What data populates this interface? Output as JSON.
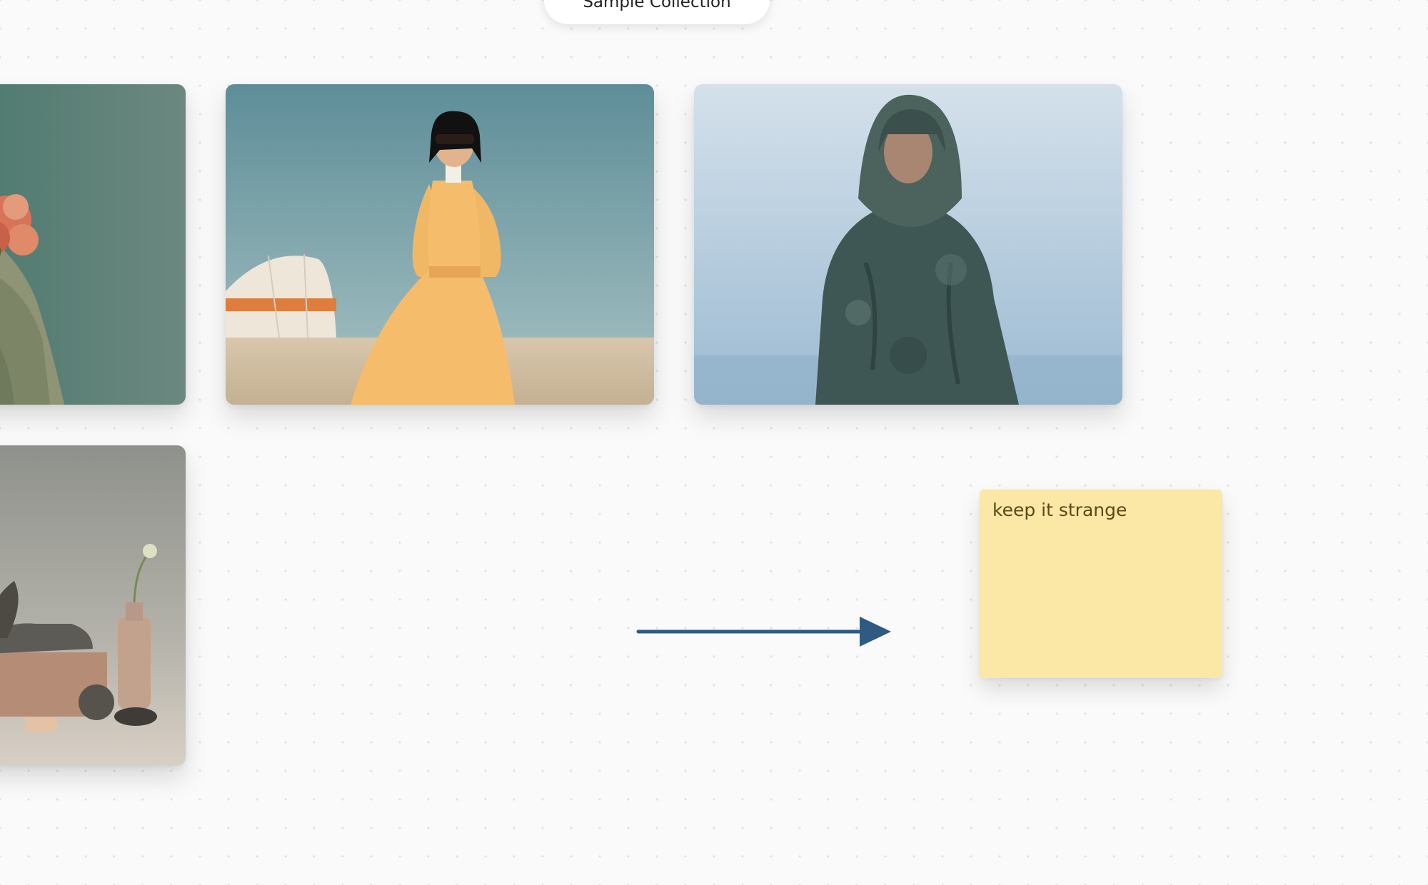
{
  "canvas": {
    "collection_title": "Sample Collection"
  },
  "images": [
    {
      "subject": "figure-with-flowers"
    },
    {
      "subject": "woman-yellow-dress-desert-dome"
    },
    {
      "subject": "hooded-man-camo-jacket"
    },
    {
      "subject": "shoe-still-life"
    }
  ],
  "arrow": {
    "color": "#2f5a82"
  },
  "sticky_note": {
    "text": "keep it strange",
    "color": "#fbe7a6"
  }
}
